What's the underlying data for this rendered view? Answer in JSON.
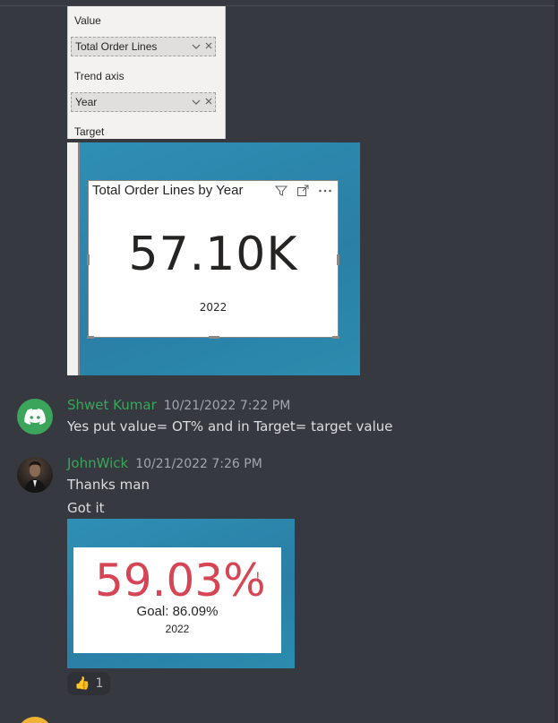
{
  "attachment1": {
    "fields_pane": {
      "value_label": "Value",
      "value_field": "Total Order Lines",
      "trend_axis_label": "Trend axis",
      "trend_axis_field": "Year",
      "target_label": "Target"
    },
    "card": {
      "title": "Total Order Lines by Year",
      "value": "57.10K",
      "year": "2022"
    }
  },
  "messages": [
    {
      "username": "Shwet Kumar",
      "username_color": "#3ba55c",
      "timestamp": "10/21/2022 7:22 PM",
      "lines": [
        "Yes put value= OT% and in Target= target value"
      ]
    },
    {
      "username": "JohnWick",
      "username_color": "#3ba55c",
      "timestamp": "10/21/2022 7:26 PM",
      "lines": [
        "Thanks man",
        "Got it"
      ]
    }
  ],
  "attachment2": {
    "kpi_value": "59.03%",
    "status_mark": "!",
    "goal": "Goal: 86.09%",
    "year": "2022",
    "value_color": "#d64554"
  },
  "reaction": {
    "emoji": "👍",
    "count": "1"
  }
}
